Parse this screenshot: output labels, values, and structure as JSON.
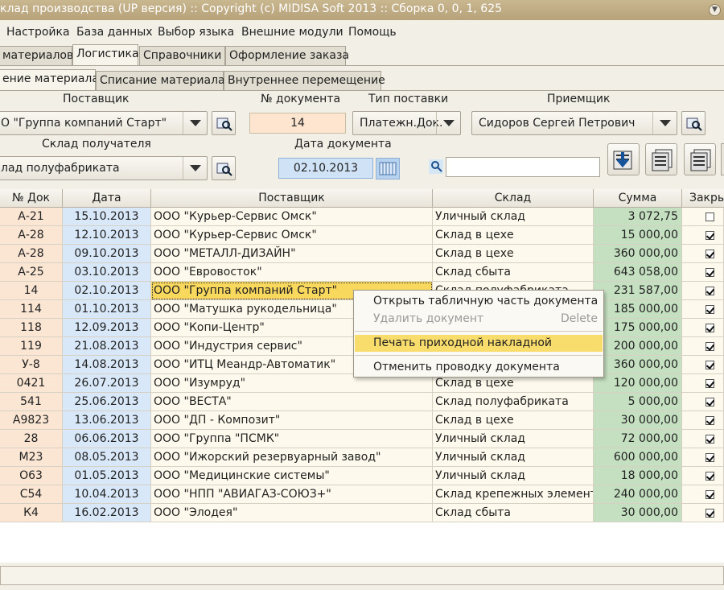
{
  "window": {
    "title": "клад производства (UP версия) :: Copyright (c) MIDISA Soft 2013 :: Сборка 0, 0, 1, 625"
  },
  "menu": [
    "Настройка",
    "База данных",
    "Выбор языка",
    "Внешние модули",
    "Помощь"
  ],
  "tabs": [
    "материалов",
    "Логистика",
    "Справочники",
    "Оформление заказа"
  ],
  "subtabs": [
    "ение материала",
    "Списание материала",
    "Внутреннее перемещение"
  ],
  "form": {
    "supplier_label": "Поставщик",
    "supplier_value": "О \"Группа компаний Старт\"",
    "docno_label": "№ документа",
    "docno_value": "14",
    "delivery_label": "Тип поставки",
    "delivery_value": "Платежн.Док.",
    "receiver_label": "Приемщик",
    "receiver_value": "Сидоров Сергей Петрович",
    "warehouse_label": "Склад получателя",
    "warehouse_value": "лад полуфабриката",
    "docdate_label": "Дата документа",
    "docdate_value": "02.10.2013",
    "search_value": ""
  },
  "table": {
    "headers": [
      "№ Док",
      "Дата",
      "Поставщик",
      "Склад",
      "Сумма",
      "Закры"
    ],
    "rows": [
      {
        "doc": "А-21",
        "date": "15.10.2013",
        "supplier": "ООО \"Курьер-Сервис Омск\"",
        "warehouse": "Уличный склад",
        "sum": "3 072,75",
        "closed": false
      },
      {
        "doc": "А-28",
        "date": "12.10.2013",
        "supplier": "ООО \"Курьер-Сервис Омск\"",
        "warehouse": "Склад в цехе",
        "sum": "15 000,00",
        "closed": true
      },
      {
        "doc": "А-28",
        "date": "09.10.2013",
        "supplier": "ООО \"МЕТАЛЛ-ДИЗАЙН\"",
        "warehouse": "Склад в цехе",
        "sum": "360 000,00",
        "closed": true
      },
      {
        "doc": "А-25",
        "date": "03.10.2013",
        "supplier": "ООО \"Евровосток\"",
        "warehouse": "Склад сбыта",
        "sum": "643 058,00",
        "closed": true
      },
      {
        "doc": "14",
        "date": "02.10.2013",
        "supplier": "ООО \"Группа компаний Старт\"",
        "warehouse": "Склад полуфабриката",
        "sum": "231 587,00",
        "closed": true
      },
      {
        "doc": "114",
        "date": "01.10.2013",
        "supplier": "ООО \"Матушка рукодельница\"",
        "warehouse": "",
        "sum": "185 000,00",
        "closed": true
      },
      {
        "doc": "118",
        "date": "12.09.2013",
        "supplier": "ООО \"Копи-Центр\"",
        "warehouse": "",
        "sum": "175 000,00",
        "closed": true
      },
      {
        "doc": "119",
        "date": "21.08.2013",
        "supplier": "ООО \"Индустрия сервис\"",
        "warehouse": "",
        "sum": "200 000,00",
        "closed": true
      },
      {
        "doc": "У-8",
        "date": "14.08.2013",
        "supplier": "ООО \"ИТЦ Меандр-Автоматик\"",
        "warehouse": "",
        "sum": "360 000,00",
        "closed": true
      },
      {
        "doc": "0421",
        "date": "26.07.2013",
        "supplier": "ООО \"Изумруд\"",
        "warehouse": "Склад в цехе",
        "sum": "120 000,00",
        "closed": true
      },
      {
        "doc": "541",
        "date": "25.06.2013",
        "supplier": "ООО \"ВЕСТА\"",
        "warehouse": "Склад полуфабриката",
        "sum": "5 000,00",
        "closed": true
      },
      {
        "doc": "А9823",
        "date": "13.06.2013",
        "supplier": "ООО \"ДП - Композит\"",
        "warehouse": "Склад в цехе",
        "sum": "30 000,00",
        "closed": true
      },
      {
        "doc": "28",
        "date": "06.06.2013",
        "supplier": "ООО \"Группа \"ПСМК\"",
        "warehouse": "Уличный склад",
        "sum": "72 000,00",
        "closed": true
      },
      {
        "doc": "М23",
        "date": "08.05.2013",
        "supplier": "ООО \"Ижорский резервуарный завод\"",
        "warehouse": "Уличный склад",
        "sum": "600 000,00",
        "closed": true
      },
      {
        "doc": "О63",
        "date": "01.05.2013",
        "supplier": "ООО \"Медицинские системы\"",
        "warehouse": "Уличный склад",
        "sum": "18 000,00",
        "closed": true
      },
      {
        "doc": "С54",
        "date": "10.04.2013",
        "supplier": "ООО \"НПП \"АВИАГАЗ-СОЮЗ+\"",
        "warehouse": "Склад крепежных элементо",
        "sum": "240 000,00",
        "closed": true
      },
      {
        "doc": "К4",
        "date": "16.02.2013",
        "supplier": "ООО \"Элодея\"",
        "warehouse": "Склад сбыта",
        "sum": "30 000,00",
        "closed": true
      }
    ],
    "selected_index": 4
  },
  "context_menu": {
    "open_table": "Открыть табличную часть документа",
    "delete_doc": "Удалить документ",
    "delete_shortcut": "Delete",
    "print_invoice": "Печать приходной накладной",
    "cancel_posting": "Отменить проводку документа"
  },
  "colors": {
    "titlebar": "#bba67e",
    "doc_column": "#fbe6d4",
    "date_column": "#d8e8f8",
    "sum_column": "#c5e0c0",
    "highlight": "#f8dc6c"
  }
}
